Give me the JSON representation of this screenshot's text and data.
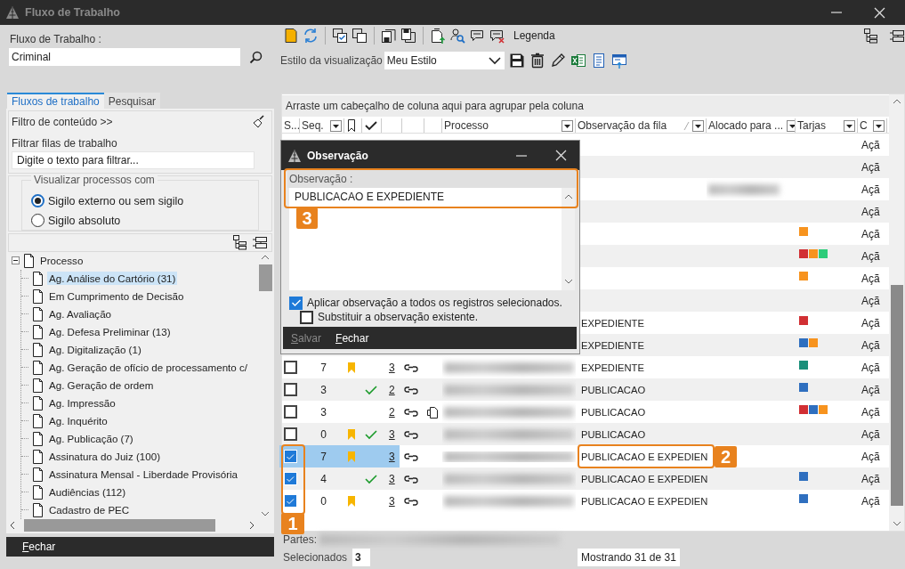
{
  "window": {
    "title": "Fluxo de Trabalho"
  },
  "workflow": {
    "label": "Fluxo de Trabalho :",
    "value": "Criminal"
  },
  "tabs": [
    {
      "label": "Fluxos de trabalho",
      "selected": true
    },
    {
      "label": "Pesquisar",
      "selected": false
    }
  ],
  "filter": {
    "toggle": "Filtro de conteúdo >>",
    "label": "Filtrar filas de trabalho",
    "placeholder": "Digite o texto para filtrar..."
  },
  "visibility": {
    "legend": "Visualizar processos com",
    "options": [
      {
        "label": "Sigilo externo ou sem sigilo",
        "selected": true
      },
      {
        "label": "Sigilo absoluto",
        "selected": false
      }
    ]
  },
  "tree": {
    "label": "Processo",
    "expanded": true,
    "children": [
      {
        "label": "Ag. Análise do Cartório (31)",
        "selected": true
      },
      {
        "label": "Em Cumprimento de Decisão",
        "selected": false
      },
      {
        "label": "Ag. Avaliação",
        "selected": false
      },
      {
        "label": "Ag. Defesa Preliminar (13)",
        "selected": false
      },
      {
        "label": "Ag. Digitalização (1)",
        "selected": false
      },
      {
        "label": "Ag. Geração de ofício de processamento c/",
        "selected": false
      },
      {
        "label": "Ag. Geração de ordem",
        "selected": false
      },
      {
        "label": "Ag. Impressão",
        "selected": false
      },
      {
        "label": "Ag. Inquérito",
        "selected": false
      },
      {
        "label": "Ag. Publicação (7)",
        "selected": false
      },
      {
        "label": "Assinatura do Juiz (100)",
        "selected": false
      },
      {
        "label": "Assinatura Mensal - Liberdade Provisória",
        "selected": false
      },
      {
        "label": "Audiências (112)",
        "selected": false
      },
      {
        "label": "Cadastro de PEC",
        "selected": false
      }
    ]
  },
  "left_footer": {
    "button": "Fechar"
  },
  "toolbar": {
    "legend": "Legenda",
    "style_label": "Estilo da visualização",
    "style_value": "Meu Estilo"
  },
  "grid": {
    "group_hint": "Arraste um cabeçalho de coluna aqui para agrupar pela coluna",
    "columns": [
      {
        "kind": "text",
        "label": "S..."
      },
      {
        "kind": "text",
        "label": "Seq.",
        "filter": true
      },
      {
        "kind": "bookmark"
      },
      {
        "kind": "check"
      },
      {
        "kind": "blank"
      },
      {
        "kind": "blank"
      },
      {
        "kind": "blank"
      },
      {
        "kind": "text",
        "label": "Processo",
        "filter": true
      },
      {
        "kind": "text",
        "label": "Observação da fila",
        "filter": true,
        "sorted": true
      },
      {
        "kind": "text",
        "label": "Alocado para ...",
        "filter": true
      },
      {
        "kind": "text",
        "label": "Tarjas",
        "filter": true
      },
      {
        "kind": "text",
        "label": "C",
        "filter": true
      }
    ],
    "rows": [
      {
        "selected": false,
        "tags": [],
        "action": "Açã"
      },
      {
        "selected": false,
        "tags": [],
        "action": "Açã"
      },
      {
        "selected": false,
        "tags": [],
        "action": "Açã"
      },
      {
        "selected": false,
        "tags": [],
        "action": "Açã"
      },
      {
        "selected": false,
        "tags": [
          {
            "color": "#f7931e"
          }
        ],
        "action": "Açã"
      },
      {
        "selected": false,
        "tags": [
          {
            "color": "#d12f33"
          },
          {
            "color": "#f7931e"
          },
          {
            "color": "#2ecc7a"
          }
        ],
        "action": "Açã"
      },
      {
        "selected": false,
        "tags": [
          {
            "color": "#f7931e"
          }
        ],
        "action": "Açã"
      },
      {
        "selected": false,
        "tags": [],
        "action": "Açã"
      },
      {
        "selected": false,
        "observation": "EXPEDIENTE",
        "tags": [
          {
            "color": "#d12f33"
          }
        ],
        "action": "Açã"
      },
      {
        "selected": false,
        "observation": "EXPEDIENTE",
        "tags": [
          {
            "color": "#2f6fbf"
          },
          {
            "color": "#f7931e"
          }
        ],
        "action": "Açã"
      },
      {
        "selected": false,
        "checked": false,
        "seq": "7",
        "bookmark": true,
        "done": false,
        "count": "3",
        "doc": false,
        "observation": "EXPEDIENTE",
        "tags": [
          {
            "color": "#1a8f7a"
          }
        ],
        "action": "Açã"
      },
      {
        "selected": false,
        "checked": false,
        "seq": "3",
        "bookmark": false,
        "done": true,
        "count": "2",
        "doc": false,
        "observation": "PUBLICACAO",
        "tags": [
          {
            "color": "#2f6fbf"
          }
        ],
        "action": "Açã"
      },
      {
        "selected": false,
        "checked": false,
        "seq": "3",
        "bookmark": false,
        "done": false,
        "count": "2",
        "doc": true,
        "observation": "PUBLICACAO",
        "tags": [
          {
            "color": "#d12f33"
          },
          {
            "color": "#2f6fbf"
          },
          {
            "color": "#f7931e"
          }
        ],
        "action": "Açã"
      },
      {
        "selected": false,
        "checked": false,
        "seq": "0",
        "bookmark": true,
        "done": true,
        "count": "3",
        "doc": false,
        "observation": "PUBLICACAO",
        "tags": [],
        "action": "Açã"
      },
      {
        "selected": true,
        "checked": true,
        "seq": "7",
        "bookmark": true,
        "done": false,
        "count": "3",
        "doc": false,
        "observation": "PUBLICACAO E EXPEDIEN",
        "tags": [],
        "action": "Açã"
      },
      {
        "selected": false,
        "checked": true,
        "seq": "4",
        "bookmark": false,
        "done": true,
        "count": "3",
        "doc": false,
        "observation": "PUBLICACAO E EXPEDIEN",
        "tags": [
          {
            "color": "#2f6fbf"
          }
        ],
        "action": "Açã"
      },
      {
        "selected": false,
        "checked": true,
        "seq": "0",
        "bookmark": true,
        "done": false,
        "count": "3",
        "doc": false,
        "observation": "PUBLICACAO E EXPEDIEN",
        "tags": [
          {
            "color": "#2f6fbf"
          }
        ],
        "action": "Açã"
      }
    ]
  },
  "status": {
    "parts_label": "Partes:",
    "selected_label": "Selecionados",
    "selected_count": "3",
    "showing": "Mostrando 31 de 31"
  },
  "dialog": {
    "title": "Observação",
    "field_label": "Observação :",
    "value": "PUBLICACAO E EXPEDIENTE",
    "options": [
      {
        "label": "Aplicar observação a todos os registros selecionados.",
        "checked": true
      },
      {
        "label": "Substituir a observação existente.",
        "checked": false
      }
    ],
    "buttons": [
      {
        "label": "Salvar",
        "disabled": true
      },
      {
        "label": "Fechar",
        "disabled": false
      }
    ]
  },
  "callouts": [
    {
      "label": "1"
    },
    {
      "label": "2"
    },
    {
      "label": "3"
    }
  ]
}
